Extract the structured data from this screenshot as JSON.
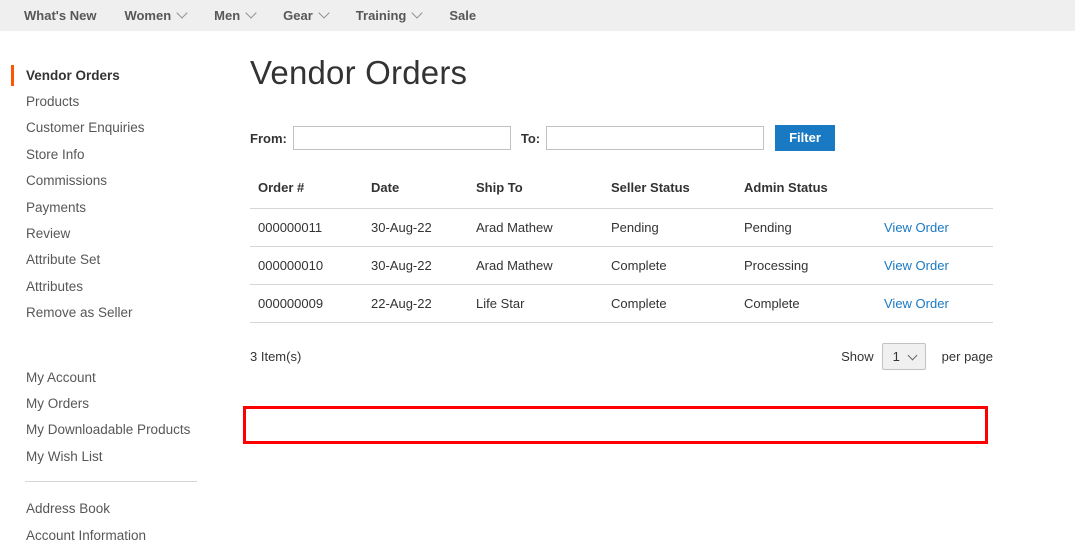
{
  "topnav": {
    "items": [
      {
        "label": "What's New",
        "has_chevron": false
      },
      {
        "label": "Women",
        "has_chevron": true
      },
      {
        "label": "Men",
        "has_chevron": true
      },
      {
        "label": "Gear",
        "has_chevron": true
      },
      {
        "label": "Training",
        "has_chevron": true
      },
      {
        "label": "Sale",
        "has_chevron": false
      }
    ]
  },
  "sidebar": {
    "group1": [
      {
        "label": "Vendor Orders",
        "current": true
      },
      {
        "label": "Products",
        "current": false
      },
      {
        "label": "Customer Enquiries",
        "current": false
      },
      {
        "label": "Store Info",
        "current": false
      },
      {
        "label": "Commissions",
        "current": false
      },
      {
        "label": "Payments",
        "current": false
      },
      {
        "label": "Review",
        "current": false
      },
      {
        "label": "Attribute Set",
        "current": false
      },
      {
        "label": "Attributes",
        "current": false
      },
      {
        "label": "Remove as Seller",
        "current": false
      }
    ],
    "group2": [
      {
        "label": "My Account",
        "current": false
      },
      {
        "label": "My Orders",
        "current": false
      },
      {
        "label": "My Downloadable Products",
        "current": false
      },
      {
        "label": "My Wish List",
        "current": false
      }
    ],
    "group3": [
      {
        "label": "Address Book",
        "current": false
      },
      {
        "label": "Account Information",
        "current": false
      }
    ]
  },
  "page": {
    "title": "Vendor Orders"
  },
  "filter": {
    "from_label": "From:",
    "from_value": "",
    "from_placeholder": "",
    "to_label": "To:",
    "to_value": "",
    "to_placeholder": "",
    "button_label": "Filter"
  },
  "table": {
    "columns": [
      "Order #",
      "Date",
      "Ship To",
      "Seller Status",
      "Admin Status",
      ""
    ],
    "rows": [
      {
        "order": "000000011",
        "date": "30-Aug-22",
        "ship_to": "Arad Mathew",
        "seller_status": "Pending",
        "admin_status": "Pending",
        "action": "View Order",
        "highlighted": false
      },
      {
        "order": "000000010",
        "date": "30-Aug-22",
        "ship_to": "Arad Mathew",
        "seller_status": "Complete",
        "admin_status": "Processing",
        "action": "View Order",
        "highlighted": false
      },
      {
        "order": "000000009",
        "date": "22-Aug-22",
        "ship_to": "Life Star",
        "seller_status": "Complete",
        "admin_status": "Complete",
        "action": "View Order",
        "highlighted": true
      }
    ]
  },
  "footer": {
    "item_count": "3 Item(s)",
    "show_label": "Show",
    "per_page_value": "1",
    "per_page_label": "per page"
  },
  "colors": {
    "accent_orange": "#ff5501",
    "link_blue": "#1979c3",
    "highlight_red": "#ff0000",
    "nav_bg": "#efefef"
  }
}
